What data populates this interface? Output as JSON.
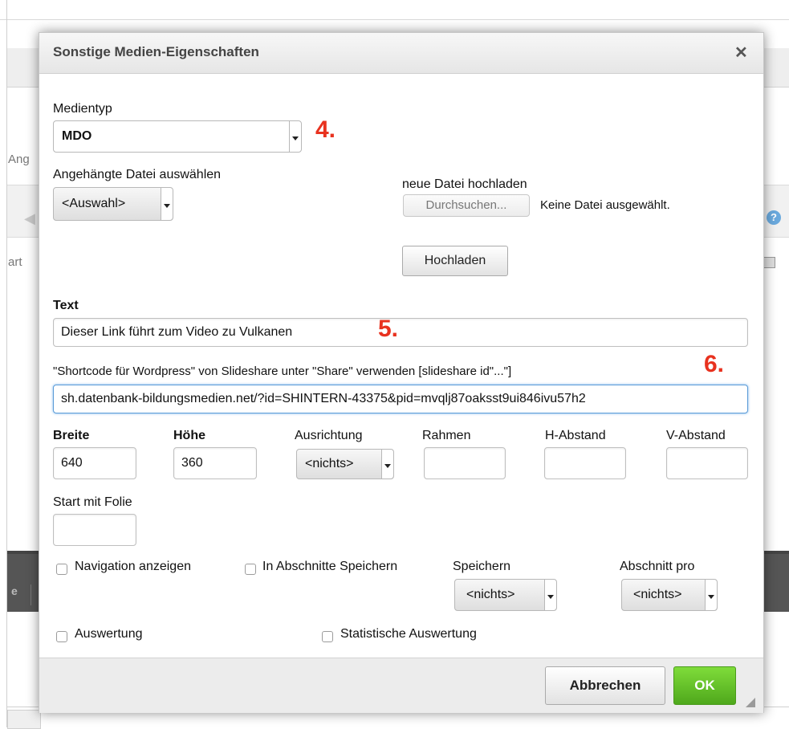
{
  "background": {
    "text_ang": "Ang",
    "text_art": "art",
    "help_icon": "?",
    "dark_label": "e"
  },
  "dialog": {
    "title": "Sonstige Medien-Eigenschaften",
    "close_glyph": "✕",
    "medientyp": {
      "label": "Medientyp",
      "value": "MDO"
    },
    "attached_file": {
      "label": "Angehängte Datei auswählen",
      "value": "<Auswahl>"
    },
    "upload": {
      "label": "neue Datei hochladen",
      "browse_button": "Durchsuchen...",
      "status": "Keine Datei ausgewählt.",
      "upload_button": "Hochladen"
    },
    "text_field": {
      "label": "Text",
      "value": "Dieser Link führt zum Video zu Vulkanen"
    },
    "shortcode_field": {
      "label": "\"Shortcode für Wordpress\" von Slideshare unter \"Share\" verwenden [slideshare id\"...\"]",
      "value": "sh.datenbank-bildungsmedien.net/?id=SHINTERN-43375&pid=mvqlj87oaksst9ui846ivu57h2"
    },
    "dimensions": {
      "breite": {
        "label": "Breite",
        "value": "640"
      },
      "hoehe": {
        "label": "Höhe",
        "value": "360"
      },
      "ausrichtung": {
        "label": "Ausrichtung",
        "value": "<nichts>"
      },
      "rahmen": {
        "label": "Rahmen",
        "value": ""
      },
      "h_abstand": {
        "label": "H-Abstand",
        "value": ""
      },
      "v_abstand": {
        "label": "V-Abstand",
        "value": ""
      }
    },
    "start_folie": {
      "label": "Start mit Folie",
      "value": ""
    },
    "checkboxes": {
      "navigation": "Navigation anzeigen",
      "abschnitte": "In Abschnitte Speichern",
      "auswertung": "Auswertung",
      "statistik": "Statistische Auswertung"
    },
    "speichern": {
      "label": "Speichern",
      "value": "<nichts>"
    },
    "abschnitt_pro": {
      "label": "Abschnitt pro",
      "value": "<nichts>"
    },
    "annotations": {
      "a4": "4.",
      "a5": "5.",
      "a6": "6."
    },
    "footer": {
      "cancel": "Abbrechen",
      "ok": "OK"
    }
  },
  "colors": {
    "annotation": "#e8321f",
    "ok_button": "#5bb824",
    "focus_border": "#5a9bd8"
  }
}
